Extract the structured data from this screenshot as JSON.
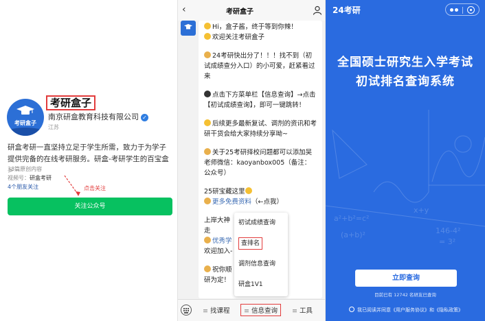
{
  "panel1": {
    "logo_text": "考研盒子",
    "account_name": "考研盒子",
    "company": "南京研盒教育科技有限公司",
    "verify_icon": "✓",
    "region": "江苏",
    "description": "研盒考研一直坚持立足于学生所需，致力于为学子提供完备的在线考研服务。研盒-考研学生的百宝盒",
    "desc_more": ">",
    "original_count": "38篇原创内容",
    "video_label": "视频号：",
    "video_name": "研盒考研",
    "friends": "4个朋友关注",
    "hint": "点击关注",
    "follow_button": "关注公众号"
  },
  "panel2": {
    "back": "‹",
    "title": "考研盒子",
    "messages": [
      "Hi，盒子酱，终于等到你辣！",
      "欢迎关注考研盒子",
      "24考研快出分了！！！找不到（初试成绩查分入口）的小可爱，赶紧看过来",
      "点击下方菜单栏【信息查询】→点击【初试成绩查询】，即可一键跳转！",
      "后续更多最新复试、调剂的资讯和考研干货会给大家持续分享呦~",
      "关于25考研择校问题都可以添加吴老师微信：kaoyanbox005（备注：公众号）",
      "25研宝藏这里",
      "更多免费资料",
      "（←点我）",
      "上岸大神",
      "划",
      "走",
      "优秀学",
      "欢迎加入-",
      "祝你顺",
      "研为定！",
      "—"
    ],
    "popup_items": [
      "初试成绩查询",
      "查排名",
      "调剂信息查询",
      "研盒1V1"
    ],
    "bottom_tabs": [
      "找课程",
      "信息查询",
      "工具"
    ],
    "tab_icon": "≡"
  },
  "panel3": {
    "brand": "24考研",
    "title_line1": "全国硕士研究生入学考试",
    "title_line2": "初试排名查询系统",
    "query_button": "立即查询",
    "count_text": "目前已有 12742 名研友已查询",
    "agree_text": "我已阅读并同意《用户服务协议》和《隐私政策》",
    "bg_color": "#2a6be0"
  }
}
